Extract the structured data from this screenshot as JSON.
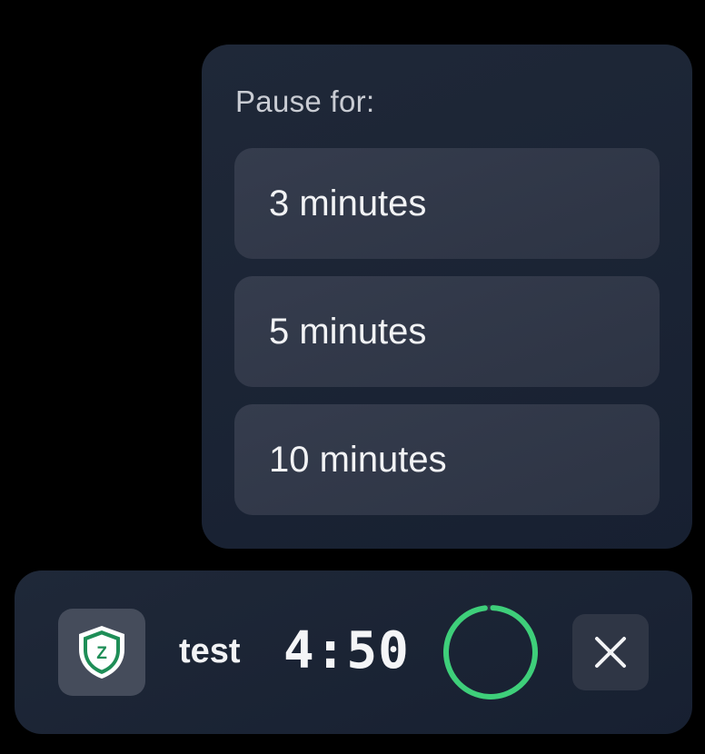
{
  "pause_menu": {
    "title": "Pause for:",
    "options": [
      {
        "label": "3 minutes"
      },
      {
        "label": "5 minutes"
      },
      {
        "label": "10 minutes"
      }
    ]
  },
  "session": {
    "app_icon": "shield-z-icon",
    "app_icon_letter": "Z",
    "name": "test",
    "time_remaining": "4:50",
    "progress_fraction": 0.97,
    "close_icon": "close-icon"
  },
  "colors": {
    "background": "#000000",
    "panel": "#1b2434",
    "option": "#323949",
    "accent_green": "#3ecf7a",
    "shield_green": "#1e8e57",
    "text": "#f2f3f5",
    "muted_text": "#c9ccd3"
  }
}
